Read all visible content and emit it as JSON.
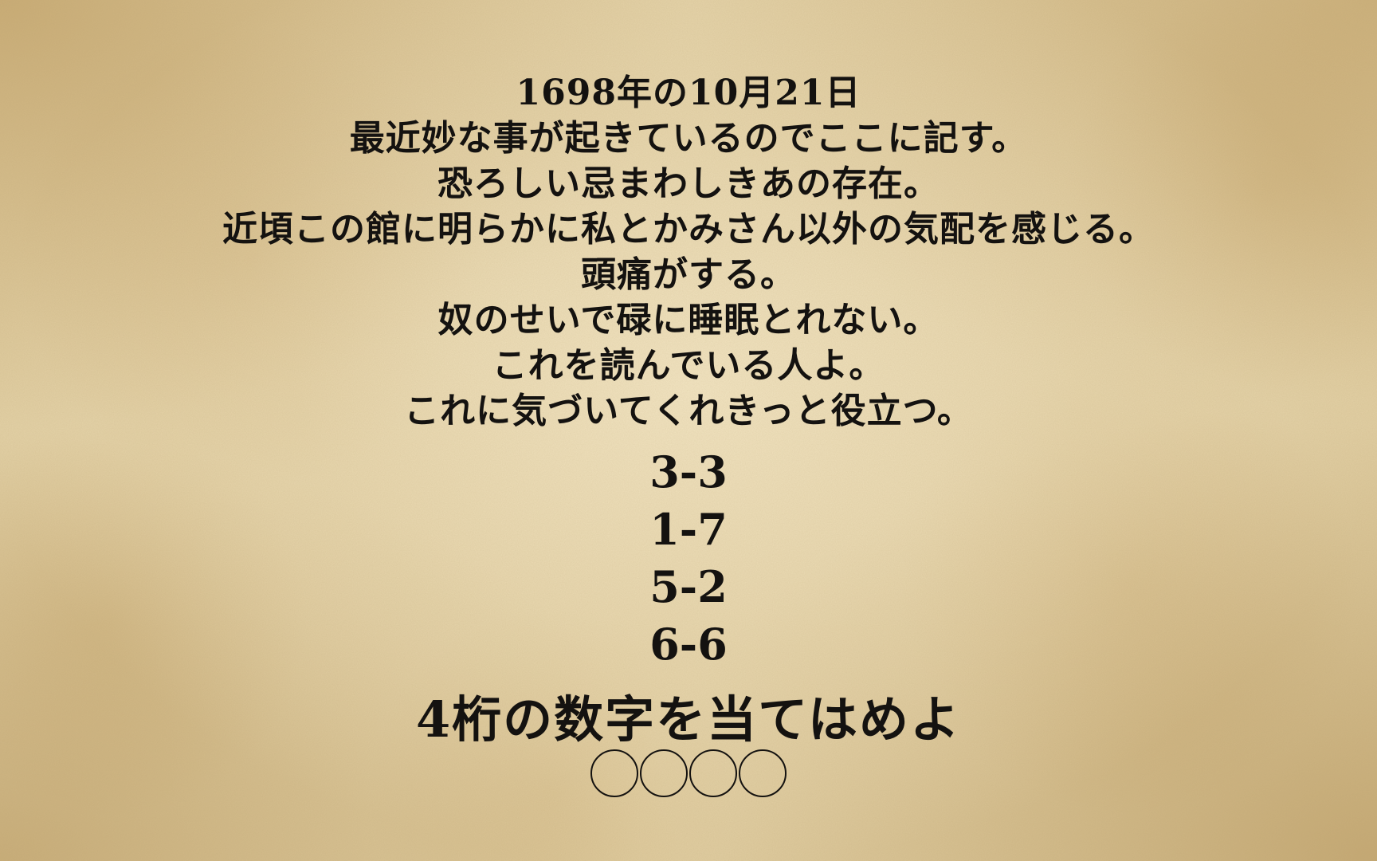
{
  "diary": {
    "lines": [
      "1698年の10月21日",
      "最近妙な事が起きているのでここに記す。",
      "恐ろしい忌まわしきあの存在。",
      "近頃この館に明らかに私とかみさん以外の気配を感じる。",
      "頭痛がする。",
      "奴のせいで碌に睡眠とれない。",
      "これを読んでいる人よ。",
      "これに気づいてくれきっと役立つ。"
    ]
  },
  "clues": [
    "3-3",
    "1-7",
    "5-2",
    "6-6"
  ],
  "puzzle": {
    "prompt": "4桁の数字を当てはめよ",
    "slots": [
      "○",
      "○",
      "○",
      "○"
    ]
  },
  "colors": {
    "text": "#141210",
    "paper": "#e3d1a6"
  }
}
